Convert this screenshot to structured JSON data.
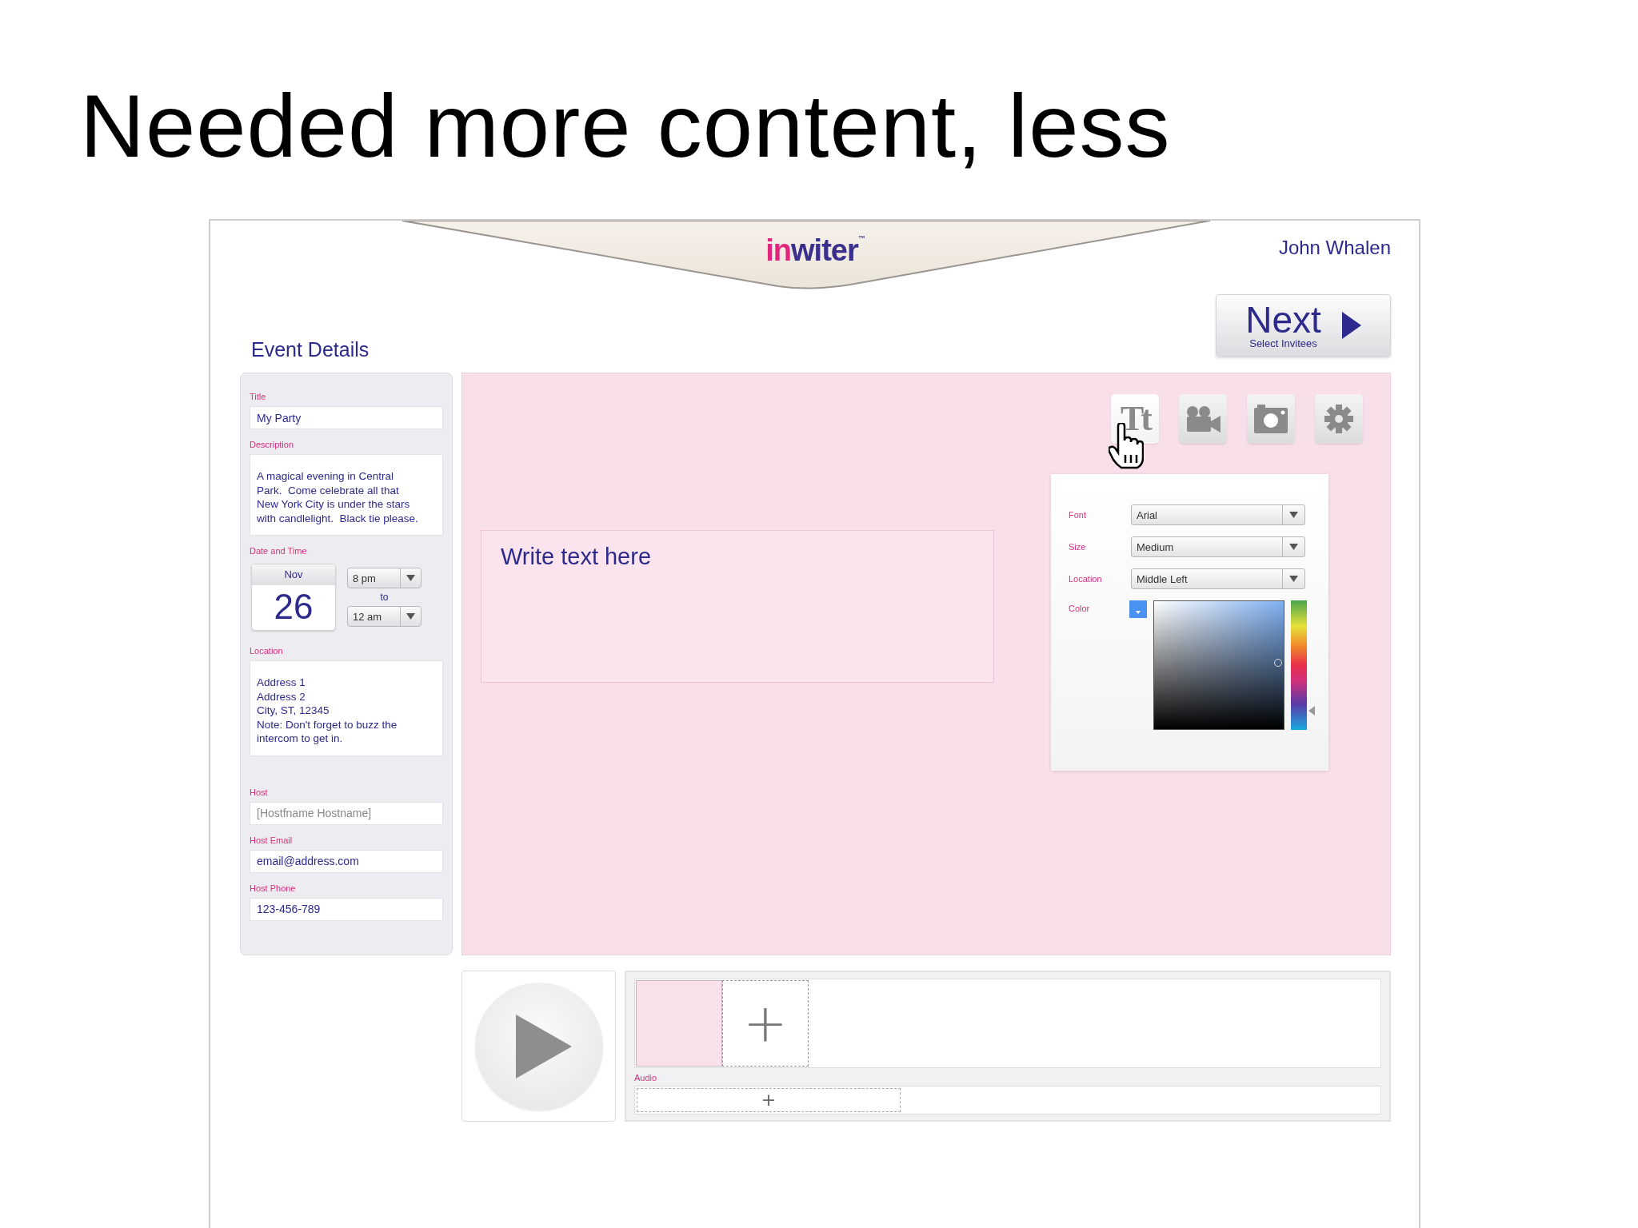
{
  "slide_title": "Needed more content, less",
  "app": {
    "logo": {
      "first": "in",
      "rest": "witer",
      "mark": "™"
    },
    "user_name": "John Whalen",
    "next_button": {
      "label": "Next",
      "sublabel": "Select Invitees"
    },
    "section_title": "Event Details",
    "fields": [
      {
        "kind": "input",
        "label": "Title",
        "value": "My Party"
      },
      {
        "kind": "textarea",
        "label": "Description",
        "lines": [
          "A magical evening in Central",
          "Park.  Come celebrate all that",
          "New York City is under the stars",
          "with candlelight.  Black tie please."
        ]
      },
      {
        "kind": "datetime",
        "label": "Date and Time",
        "month": "Nov",
        "day": "26",
        "start": "8 pm",
        "connector": "to",
        "end": "12 am"
      },
      {
        "kind": "textarea",
        "label": "Location",
        "lines": [
          "Address 1",
          "Address 2",
          "City, ST, 12345",
          "Note: Don't forget to buzz the",
          "intercom to get in."
        ]
      },
      {
        "kind": "input",
        "label": "Host",
        "placeholder": "[Hostfname Hostname]"
      },
      {
        "kind": "input",
        "label": "Host Email",
        "value": "email@address.com"
      },
      {
        "kind": "input",
        "label": "Host Phone",
        "value": "123-456-789"
      }
    ],
    "canvas": {
      "text_box": "Write text here",
      "tools": [
        {
          "kind": "text",
          "label": "Tt",
          "selected": true
        },
        {
          "kind": "video",
          "selected": false
        },
        {
          "kind": "camera",
          "selected": false
        },
        {
          "kind": "settings",
          "selected": false
        }
      ],
      "format_panel": {
        "rows": [
          {
            "label": "Font",
            "value": "Arial"
          },
          {
            "label": "Size",
            "value": "Medium"
          },
          {
            "label": "Location",
            "value": "Middle Left"
          }
        ],
        "color_label": "Color",
        "hue_slider": {
          "level": 0.12
        }
      }
    },
    "timeline": {
      "add_slide": "+",
      "audio_label": "Audio",
      "add_audio": "+"
    }
  }
}
